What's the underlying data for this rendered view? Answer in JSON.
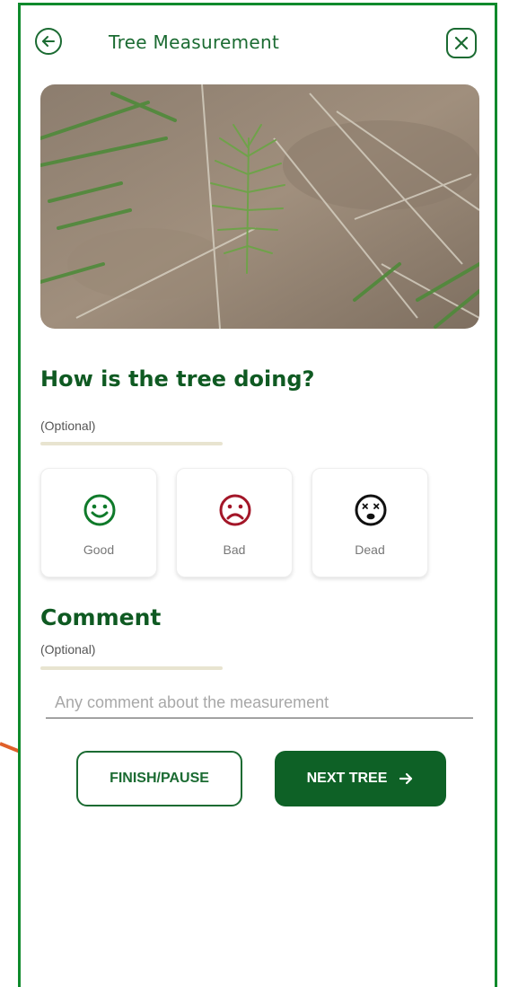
{
  "header": {
    "title": "Tree Measurement"
  },
  "icons": {
    "back": "arrow-left-icon",
    "close": "close-icon",
    "good": "smile-icon",
    "bad": "frown-icon",
    "dead": "dead-face-icon"
  },
  "health": {
    "question": "How is the tree doing?",
    "optional": "(Optional)",
    "options": [
      {
        "label": "Good",
        "color": "#0f7a2a"
      },
      {
        "label": "Bad",
        "color": "#a31628"
      },
      {
        "label": "Dead",
        "color": "#111111"
      }
    ]
  },
  "comment": {
    "heading": "Comment",
    "optional": "(Optional)",
    "placeholder": "Any comment about the measurement",
    "value": ""
  },
  "actions": {
    "finish_label": "FINISH/PAUSE",
    "next_label": "NEXT TREE"
  },
  "colors": {
    "frame": "#0f8a2c",
    "brand_dark": "#0e6126",
    "annotation_arrow": "#e0602a"
  }
}
